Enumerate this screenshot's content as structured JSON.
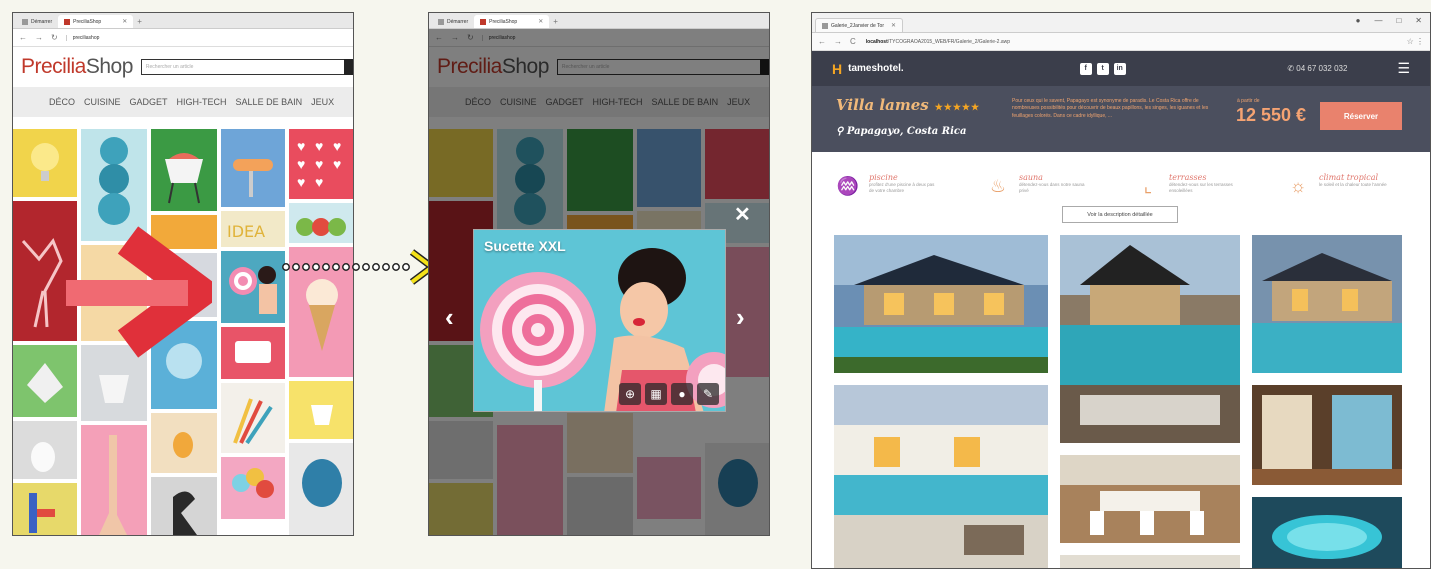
{
  "shop": {
    "tabs": [
      {
        "label": "Démarrer",
        "active": false
      },
      {
        "label": "PreciliaShop",
        "active": true
      }
    ],
    "address": "preciliashop",
    "logo_part1": "Precilia",
    "logo_part2": "Shop",
    "search_placeholder": "Rechercher un article",
    "menu": [
      "DÉCO",
      "CUISINE",
      "GADGET",
      "HIGH-TECH",
      "SALLE DE BAIN",
      "JEUX"
    ]
  },
  "lightbox": {
    "title": "Sucette XXL",
    "tools": [
      "zoom-in-icon",
      "grid-icon",
      "user-icon",
      "edit-icon"
    ],
    "prev": "‹",
    "next": "›",
    "close": "✕"
  },
  "hotel": {
    "tab_label": "Galerie_2Janvier de Tor",
    "address_host": "localhost",
    "address_path": "/TYCOGRAOA2015_WEB/FR/Galerie_2/Galerie-2.awp",
    "brand": "tameshotel.",
    "social": [
      "f",
      "t",
      "in"
    ],
    "phone": "04 67 032 032",
    "villa_name": "Villa lames",
    "stars": "★★★★★",
    "location": "Papagayo, Costa Rica",
    "description": "Pour ceux qui le savent, Papagayo est synonyme de paradis. Le Costa Rica offre de nombreuses possibilités pour découvrir de beaux papillons, les singes, les iguanes et les feuillages colorés. Dans ce cadre idyllique, ...",
    "from_label": "à partir de",
    "price": "12 550 €",
    "book_button": "Réserver",
    "features": [
      {
        "icon": "pool-icon",
        "title": "piscine",
        "subtitle": "profitez d'une piscine à deux pas de votre chambre"
      },
      {
        "icon": "sauna-icon",
        "title": "sauna",
        "subtitle": "détendez-vous dans notre sauna privé"
      },
      {
        "icon": "deckchair-icon",
        "title": "terrasses",
        "subtitle": "détendez-vous sur les terrasses ensoleillées"
      },
      {
        "icon": "sun-icon",
        "title": "climat tropical",
        "subtitle": "le soleil et la chaleur toute l'année"
      }
    ],
    "detail_button": "Voir la description détaillée"
  },
  "colors": {
    "shop_red": "#c0392b",
    "arrow_red": "#e0303a",
    "dots_yellow": "#f4e21a",
    "hotel_dark": "#3b3e4b",
    "hotel_accent": "#e9826d"
  }
}
